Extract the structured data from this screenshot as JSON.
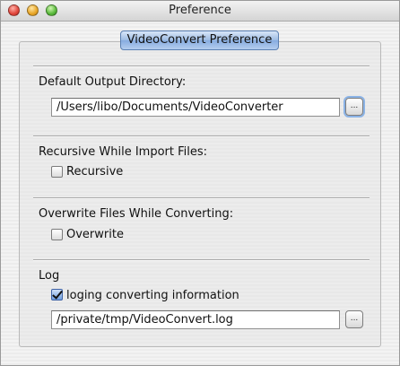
{
  "window": {
    "title": "Preference"
  },
  "tab": {
    "label": "VideoConvert Preference"
  },
  "output": {
    "label": "Default Output Directory:",
    "path": "/Users/libo/Documents/VideoConverter",
    "browse_label": "..."
  },
  "recursive": {
    "label": "Recursive While Import Files:",
    "checkbox_label": "Recursive",
    "checked": false
  },
  "overwrite": {
    "label": "Overwrite Files While Converting:",
    "checkbox_label": "Overwrite",
    "checked": false
  },
  "log": {
    "label": "Log",
    "checkbox_label": "loging converting information",
    "checked": true,
    "path": "/private/tmp/VideoConvert.log",
    "browse_label": "..."
  }
}
